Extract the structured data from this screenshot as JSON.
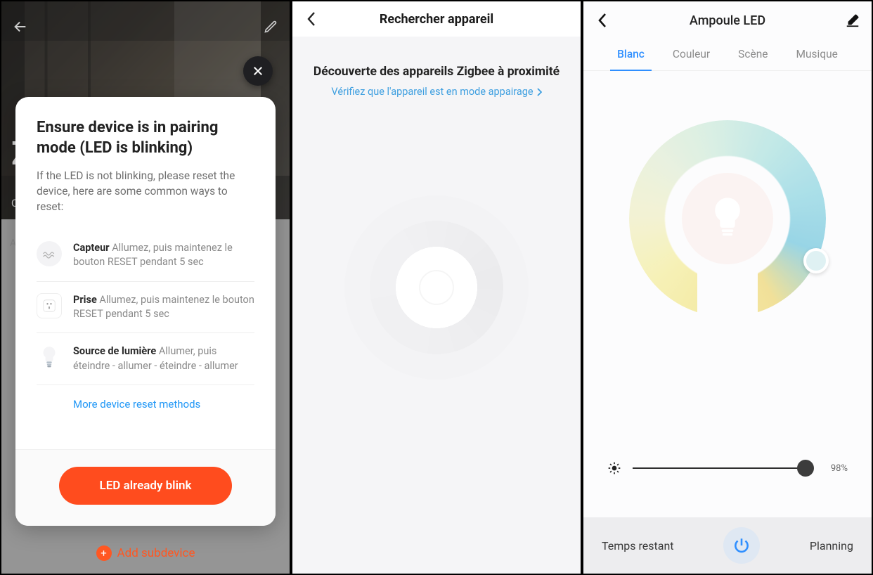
{
  "screen1": {
    "background_hint": "Z",
    "background_tab": "C",
    "behind_list_label": "A",
    "add_subdevice": "Add subdevice",
    "modal": {
      "title": "Ensure device is in pairing mode (LED is blinking)",
      "subtitle": "If the LED is not blinking, please reset the device, here are some common ways to reset:",
      "items": [
        {
          "name": "Capteur",
          "desc": "Allumez, puis maintenez le bouton RESET pendant 5 sec"
        },
        {
          "name": "Prise",
          "desc": "Allumez, puis maintenez le bouton RESET pendant 5 sec"
        },
        {
          "name": "Source de lumière",
          "desc": "Allumer, puis éteindre - allumer - éteindre - allumer"
        }
      ],
      "more_link": "More device reset methods",
      "cta": "LED already blink"
    }
  },
  "screen2": {
    "header": "Rechercher appareil",
    "heading": "Découverte des appareils Zigbee à proximité",
    "link": "Vérifiez que l'appareil est en mode appairage"
  },
  "screen3": {
    "header": "Ampoule LED",
    "tabs": [
      "Blanc",
      "Couleur",
      "Scène",
      "Musique"
    ],
    "active_tab_index": 0,
    "brightness_pct": "98%",
    "brightness_value": 98,
    "footer": {
      "left": "Temps restant",
      "right": "Planning"
    }
  }
}
